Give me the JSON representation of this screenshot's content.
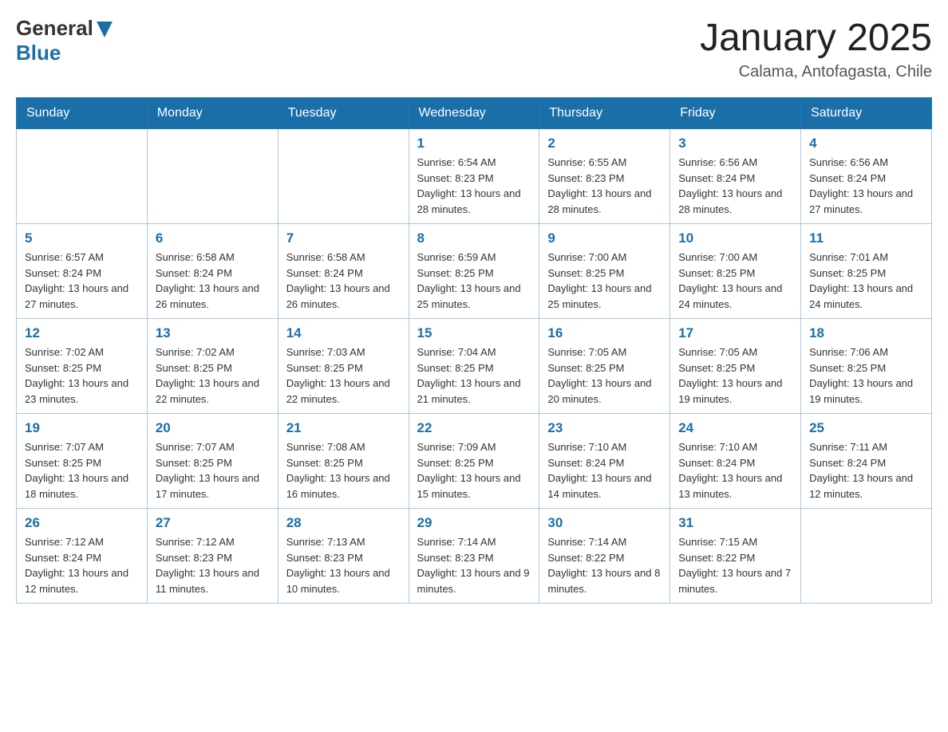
{
  "header": {
    "logo_general": "General",
    "logo_blue": "Blue",
    "month_title": "January 2025",
    "location": "Calama, Antofagasta, Chile"
  },
  "days_of_week": [
    "Sunday",
    "Monday",
    "Tuesday",
    "Wednesday",
    "Thursday",
    "Friday",
    "Saturday"
  ],
  "weeks": [
    [
      {
        "day": "",
        "info": ""
      },
      {
        "day": "",
        "info": ""
      },
      {
        "day": "",
        "info": ""
      },
      {
        "day": "1",
        "info": "Sunrise: 6:54 AM\nSunset: 8:23 PM\nDaylight: 13 hours and 28 minutes."
      },
      {
        "day": "2",
        "info": "Sunrise: 6:55 AM\nSunset: 8:23 PM\nDaylight: 13 hours and 28 minutes."
      },
      {
        "day": "3",
        "info": "Sunrise: 6:56 AM\nSunset: 8:24 PM\nDaylight: 13 hours and 28 minutes."
      },
      {
        "day": "4",
        "info": "Sunrise: 6:56 AM\nSunset: 8:24 PM\nDaylight: 13 hours and 27 minutes."
      }
    ],
    [
      {
        "day": "5",
        "info": "Sunrise: 6:57 AM\nSunset: 8:24 PM\nDaylight: 13 hours and 27 minutes."
      },
      {
        "day": "6",
        "info": "Sunrise: 6:58 AM\nSunset: 8:24 PM\nDaylight: 13 hours and 26 minutes."
      },
      {
        "day": "7",
        "info": "Sunrise: 6:58 AM\nSunset: 8:24 PM\nDaylight: 13 hours and 26 minutes."
      },
      {
        "day": "8",
        "info": "Sunrise: 6:59 AM\nSunset: 8:25 PM\nDaylight: 13 hours and 25 minutes."
      },
      {
        "day": "9",
        "info": "Sunrise: 7:00 AM\nSunset: 8:25 PM\nDaylight: 13 hours and 25 minutes."
      },
      {
        "day": "10",
        "info": "Sunrise: 7:00 AM\nSunset: 8:25 PM\nDaylight: 13 hours and 24 minutes."
      },
      {
        "day": "11",
        "info": "Sunrise: 7:01 AM\nSunset: 8:25 PM\nDaylight: 13 hours and 24 minutes."
      }
    ],
    [
      {
        "day": "12",
        "info": "Sunrise: 7:02 AM\nSunset: 8:25 PM\nDaylight: 13 hours and 23 minutes."
      },
      {
        "day": "13",
        "info": "Sunrise: 7:02 AM\nSunset: 8:25 PM\nDaylight: 13 hours and 22 minutes."
      },
      {
        "day": "14",
        "info": "Sunrise: 7:03 AM\nSunset: 8:25 PM\nDaylight: 13 hours and 22 minutes."
      },
      {
        "day": "15",
        "info": "Sunrise: 7:04 AM\nSunset: 8:25 PM\nDaylight: 13 hours and 21 minutes."
      },
      {
        "day": "16",
        "info": "Sunrise: 7:05 AM\nSunset: 8:25 PM\nDaylight: 13 hours and 20 minutes."
      },
      {
        "day": "17",
        "info": "Sunrise: 7:05 AM\nSunset: 8:25 PM\nDaylight: 13 hours and 19 minutes."
      },
      {
        "day": "18",
        "info": "Sunrise: 7:06 AM\nSunset: 8:25 PM\nDaylight: 13 hours and 19 minutes."
      }
    ],
    [
      {
        "day": "19",
        "info": "Sunrise: 7:07 AM\nSunset: 8:25 PM\nDaylight: 13 hours and 18 minutes."
      },
      {
        "day": "20",
        "info": "Sunrise: 7:07 AM\nSunset: 8:25 PM\nDaylight: 13 hours and 17 minutes."
      },
      {
        "day": "21",
        "info": "Sunrise: 7:08 AM\nSunset: 8:25 PM\nDaylight: 13 hours and 16 minutes."
      },
      {
        "day": "22",
        "info": "Sunrise: 7:09 AM\nSunset: 8:25 PM\nDaylight: 13 hours and 15 minutes."
      },
      {
        "day": "23",
        "info": "Sunrise: 7:10 AM\nSunset: 8:24 PM\nDaylight: 13 hours and 14 minutes."
      },
      {
        "day": "24",
        "info": "Sunrise: 7:10 AM\nSunset: 8:24 PM\nDaylight: 13 hours and 13 minutes."
      },
      {
        "day": "25",
        "info": "Sunrise: 7:11 AM\nSunset: 8:24 PM\nDaylight: 13 hours and 12 minutes."
      }
    ],
    [
      {
        "day": "26",
        "info": "Sunrise: 7:12 AM\nSunset: 8:24 PM\nDaylight: 13 hours and 12 minutes."
      },
      {
        "day": "27",
        "info": "Sunrise: 7:12 AM\nSunset: 8:23 PM\nDaylight: 13 hours and 11 minutes."
      },
      {
        "day": "28",
        "info": "Sunrise: 7:13 AM\nSunset: 8:23 PM\nDaylight: 13 hours and 10 minutes."
      },
      {
        "day": "29",
        "info": "Sunrise: 7:14 AM\nSunset: 8:23 PM\nDaylight: 13 hours and 9 minutes."
      },
      {
        "day": "30",
        "info": "Sunrise: 7:14 AM\nSunset: 8:22 PM\nDaylight: 13 hours and 8 minutes."
      },
      {
        "day": "31",
        "info": "Sunrise: 7:15 AM\nSunset: 8:22 PM\nDaylight: 13 hours and 7 minutes."
      },
      {
        "day": "",
        "info": ""
      }
    ]
  ]
}
